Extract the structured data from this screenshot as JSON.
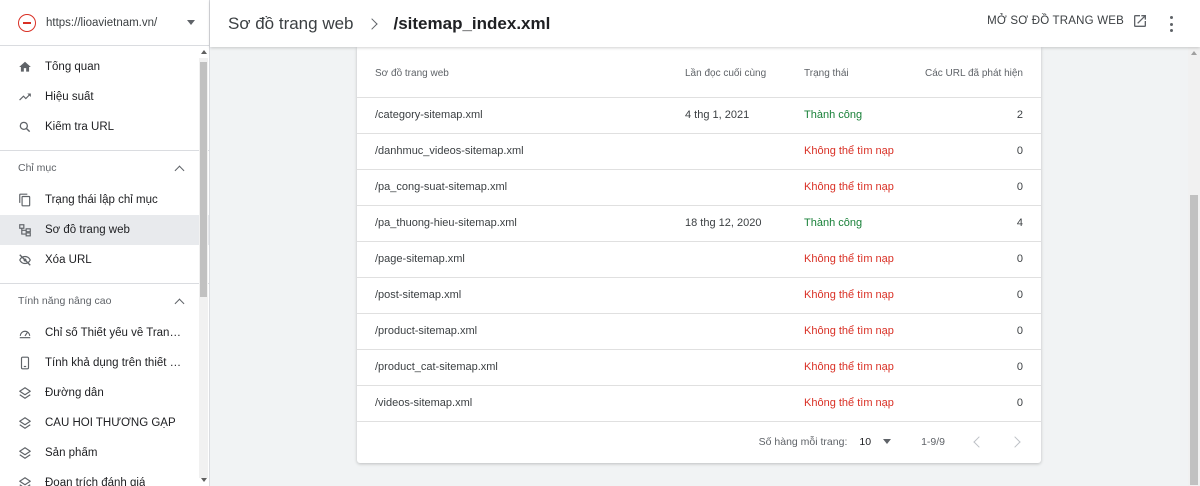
{
  "property": {
    "url": "https://lioavietnam.vn/"
  },
  "nav": {
    "top": [
      {
        "label": "Tổng quan",
        "icon": "home-icon"
      },
      {
        "label": "Hiệu suất",
        "icon": "trending-up-icon"
      },
      {
        "label": "Kiểm tra URL",
        "icon": "search-icon"
      }
    ],
    "index_section": {
      "title": "Chỉ mục",
      "items": [
        {
          "label": "Trạng thái lập chỉ mục",
          "icon": "copy-icon"
        },
        {
          "label": "Sơ đồ trang web",
          "icon": "sitemap-icon",
          "active": true
        },
        {
          "label": "Xóa URL",
          "icon": "eye-off-icon"
        }
      ]
    },
    "enhancements_section": {
      "title": "Tính năng nâng cao",
      "items": [
        {
          "label": "Chỉ số Thiết yếu về Trang ...",
          "icon": "speed-gauge-icon"
        },
        {
          "label": "Tính khả dụng trên thiết bị...",
          "icon": "phone-icon"
        },
        {
          "label": "Đường dẫn",
          "icon": "layers-icon"
        },
        {
          "label": "CÂU HỎI THƯỜNG GẶP",
          "icon": "layers-icon"
        },
        {
          "label": "Sản phẩm",
          "icon": "layers-icon"
        },
        {
          "label": "Đoạn trích đánh giá",
          "icon": "layers-icon"
        }
      ]
    }
  },
  "header": {
    "parent": "Sơ đồ trang web",
    "title": "/sitemap_index.xml",
    "open_button": "MỞ SƠ ĐỒ TRANG WEB"
  },
  "table": {
    "columns": [
      "Sơ đồ trang web",
      "Lần đọc cuối cùng",
      "Trạng thái",
      "Các URL đã phát hiện"
    ],
    "rows": [
      {
        "sitemap": "/category-sitemap.xml",
        "last_read": "4 thg 1, 2021",
        "status": "Thành công",
        "status_type": "ok",
        "urls": "2"
      },
      {
        "sitemap": "/danhmuc_videos-sitemap.xml",
        "last_read": "",
        "status": "Không thể tìm nạp",
        "status_type": "err",
        "urls": "0"
      },
      {
        "sitemap": "/pa_cong-suat-sitemap.xml",
        "last_read": "",
        "status": "Không thể tìm nạp",
        "status_type": "err",
        "urls": "0"
      },
      {
        "sitemap": "/pa_thuong-hieu-sitemap.xml",
        "last_read": "18 thg 12, 2020",
        "status": "Thành công",
        "status_type": "ok",
        "urls": "4"
      },
      {
        "sitemap": "/page-sitemap.xml",
        "last_read": "",
        "status": "Không thể tìm nạp",
        "status_type": "err",
        "urls": "0"
      },
      {
        "sitemap": "/post-sitemap.xml",
        "last_read": "",
        "status": "Không thể tìm nạp",
        "status_type": "err",
        "urls": "0"
      },
      {
        "sitemap": "/product-sitemap.xml",
        "last_read": "",
        "status": "Không thể tìm nạp",
        "status_type": "err",
        "urls": "0"
      },
      {
        "sitemap": "/product_cat-sitemap.xml",
        "last_read": "",
        "status": "Không thể tìm nạp",
        "status_type": "err",
        "urls": "0"
      },
      {
        "sitemap": "/videos-sitemap.xml",
        "last_read": "",
        "status": "Không thể tìm nạp",
        "status_type": "err",
        "urls": "0"
      }
    ]
  },
  "pager": {
    "rows_label": "Số hàng mỗi trang:",
    "rows_value": "10",
    "range": "1-9/9"
  },
  "colors": {
    "success": "#188038",
    "error": "#d93025",
    "active_bg": "#e8eaed"
  }
}
